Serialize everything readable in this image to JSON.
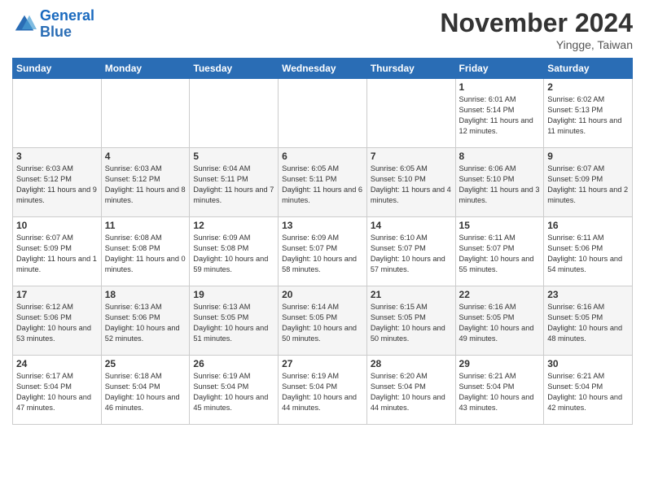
{
  "header": {
    "logo_line1": "General",
    "logo_line2": "Blue",
    "month": "November 2024",
    "location": "Yingge, Taiwan"
  },
  "weekdays": [
    "Sunday",
    "Monday",
    "Tuesday",
    "Wednesday",
    "Thursday",
    "Friday",
    "Saturday"
  ],
  "weeks": [
    [
      {
        "day": "",
        "info": ""
      },
      {
        "day": "",
        "info": ""
      },
      {
        "day": "",
        "info": ""
      },
      {
        "day": "",
        "info": ""
      },
      {
        "day": "",
        "info": ""
      },
      {
        "day": "1",
        "info": "Sunrise: 6:01 AM\nSunset: 5:14 PM\nDaylight: 11 hours and 12 minutes."
      },
      {
        "day": "2",
        "info": "Sunrise: 6:02 AM\nSunset: 5:13 PM\nDaylight: 11 hours and 11 minutes."
      }
    ],
    [
      {
        "day": "3",
        "info": "Sunrise: 6:03 AM\nSunset: 5:12 PM\nDaylight: 11 hours and 9 minutes."
      },
      {
        "day": "4",
        "info": "Sunrise: 6:03 AM\nSunset: 5:12 PM\nDaylight: 11 hours and 8 minutes."
      },
      {
        "day": "5",
        "info": "Sunrise: 6:04 AM\nSunset: 5:11 PM\nDaylight: 11 hours and 7 minutes."
      },
      {
        "day": "6",
        "info": "Sunrise: 6:05 AM\nSunset: 5:11 PM\nDaylight: 11 hours and 6 minutes."
      },
      {
        "day": "7",
        "info": "Sunrise: 6:05 AM\nSunset: 5:10 PM\nDaylight: 11 hours and 4 minutes."
      },
      {
        "day": "8",
        "info": "Sunrise: 6:06 AM\nSunset: 5:10 PM\nDaylight: 11 hours and 3 minutes."
      },
      {
        "day": "9",
        "info": "Sunrise: 6:07 AM\nSunset: 5:09 PM\nDaylight: 11 hours and 2 minutes."
      }
    ],
    [
      {
        "day": "10",
        "info": "Sunrise: 6:07 AM\nSunset: 5:09 PM\nDaylight: 11 hours and 1 minute."
      },
      {
        "day": "11",
        "info": "Sunrise: 6:08 AM\nSunset: 5:08 PM\nDaylight: 11 hours and 0 minutes."
      },
      {
        "day": "12",
        "info": "Sunrise: 6:09 AM\nSunset: 5:08 PM\nDaylight: 10 hours and 59 minutes."
      },
      {
        "day": "13",
        "info": "Sunrise: 6:09 AM\nSunset: 5:07 PM\nDaylight: 10 hours and 58 minutes."
      },
      {
        "day": "14",
        "info": "Sunrise: 6:10 AM\nSunset: 5:07 PM\nDaylight: 10 hours and 57 minutes."
      },
      {
        "day": "15",
        "info": "Sunrise: 6:11 AM\nSunset: 5:07 PM\nDaylight: 10 hours and 55 minutes."
      },
      {
        "day": "16",
        "info": "Sunrise: 6:11 AM\nSunset: 5:06 PM\nDaylight: 10 hours and 54 minutes."
      }
    ],
    [
      {
        "day": "17",
        "info": "Sunrise: 6:12 AM\nSunset: 5:06 PM\nDaylight: 10 hours and 53 minutes."
      },
      {
        "day": "18",
        "info": "Sunrise: 6:13 AM\nSunset: 5:06 PM\nDaylight: 10 hours and 52 minutes."
      },
      {
        "day": "19",
        "info": "Sunrise: 6:13 AM\nSunset: 5:05 PM\nDaylight: 10 hours and 51 minutes."
      },
      {
        "day": "20",
        "info": "Sunrise: 6:14 AM\nSunset: 5:05 PM\nDaylight: 10 hours and 50 minutes."
      },
      {
        "day": "21",
        "info": "Sunrise: 6:15 AM\nSunset: 5:05 PM\nDaylight: 10 hours and 50 minutes."
      },
      {
        "day": "22",
        "info": "Sunrise: 6:16 AM\nSunset: 5:05 PM\nDaylight: 10 hours and 49 minutes."
      },
      {
        "day": "23",
        "info": "Sunrise: 6:16 AM\nSunset: 5:05 PM\nDaylight: 10 hours and 48 minutes."
      }
    ],
    [
      {
        "day": "24",
        "info": "Sunrise: 6:17 AM\nSunset: 5:04 PM\nDaylight: 10 hours and 47 minutes."
      },
      {
        "day": "25",
        "info": "Sunrise: 6:18 AM\nSunset: 5:04 PM\nDaylight: 10 hours and 46 minutes."
      },
      {
        "day": "26",
        "info": "Sunrise: 6:19 AM\nSunset: 5:04 PM\nDaylight: 10 hours and 45 minutes."
      },
      {
        "day": "27",
        "info": "Sunrise: 6:19 AM\nSunset: 5:04 PM\nDaylight: 10 hours and 44 minutes."
      },
      {
        "day": "28",
        "info": "Sunrise: 6:20 AM\nSunset: 5:04 PM\nDaylight: 10 hours and 44 minutes."
      },
      {
        "day": "29",
        "info": "Sunrise: 6:21 AM\nSunset: 5:04 PM\nDaylight: 10 hours and 43 minutes."
      },
      {
        "day": "30",
        "info": "Sunrise: 6:21 AM\nSunset: 5:04 PM\nDaylight: 10 hours and 42 minutes."
      }
    ]
  ]
}
